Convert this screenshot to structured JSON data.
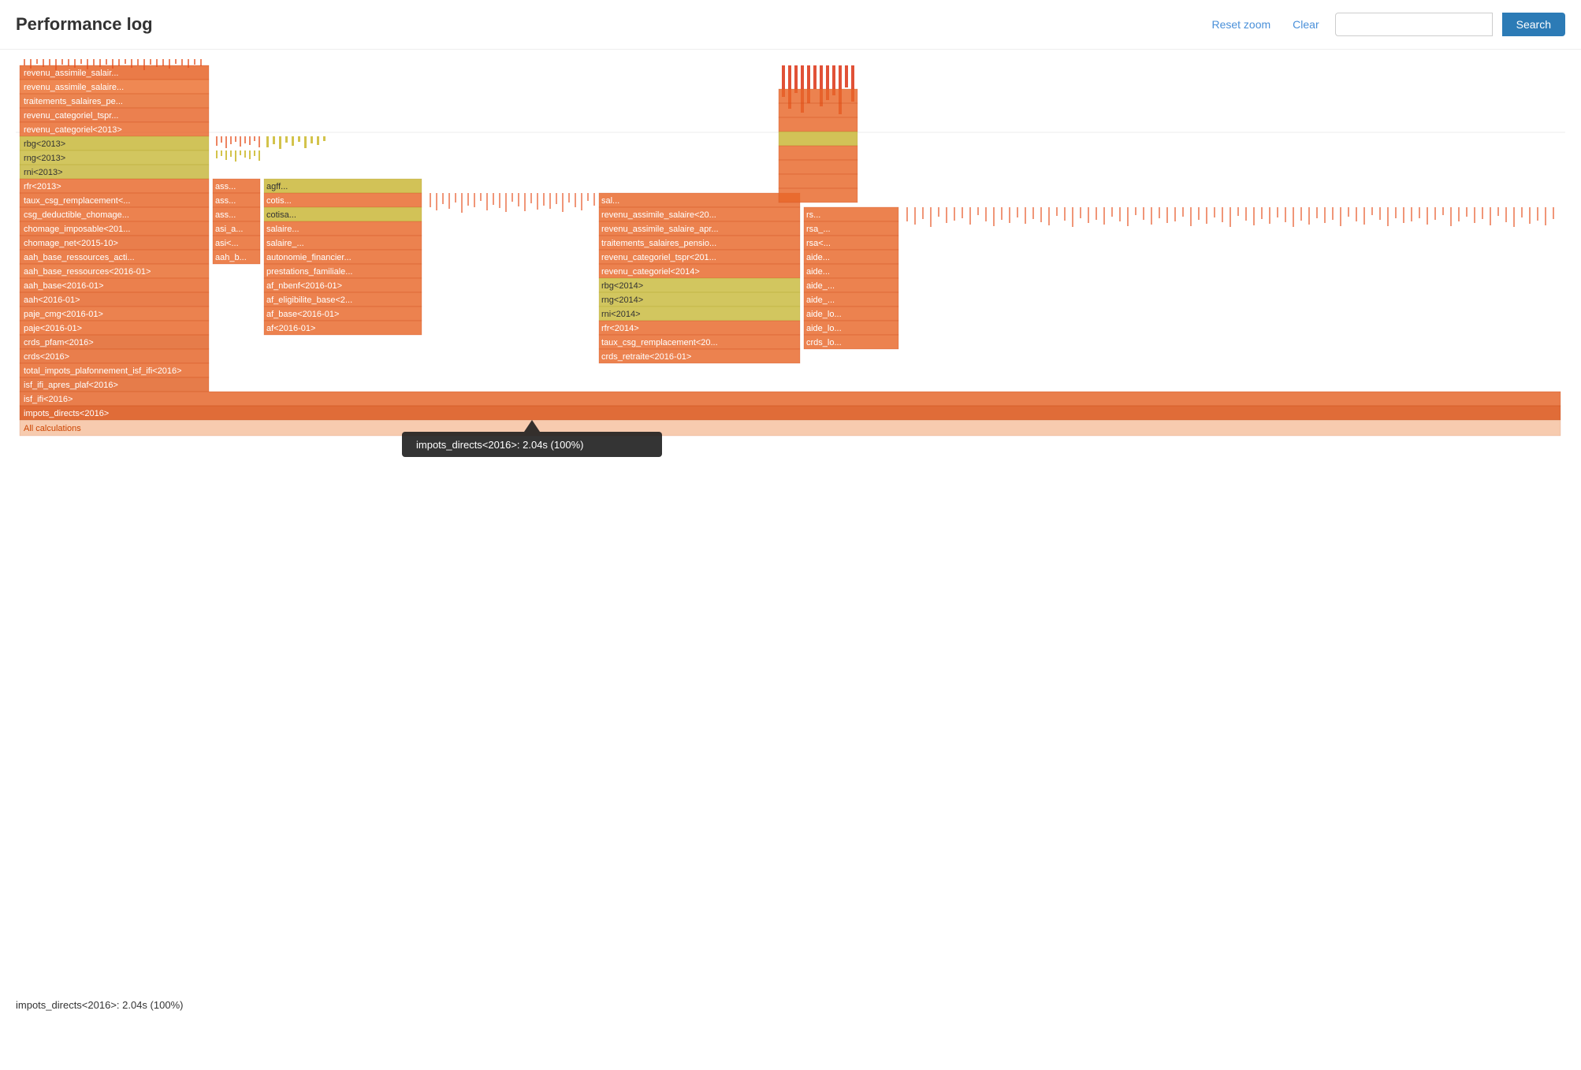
{
  "header": {
    "title": "Performance log",
    "reset_zoom_label": "Reset zoom",
    "clear_label": "Clear",
    "search_placeholder": "",
    "search_button_label": "Search"
  },
  "status_bar": {
    "text": "impots_directs<2016>: 2.04s (100%)"
  },
  "tooltip": {
    "text": "impots_directs<2016>: 2.04s (100%)"
  },
  "chart": {
    "all_calculations_label": "All calculations"
  },
  "rows": [
    {
      "label": "revenu_assimile_salair...",
      "depth": 8,
      "color": "orange"
    },
    {
      "label": "revenu_assimile_salaire...",
      "depth": 9,
      "color": "orange"
    },
    {
      "label": "traitements_salaires_pe...",
      "depth": 10,
      "color": "orange"
    },
    {
      "label": "revenu_categoriel_tspr...",
      "depth": 11,
      "color": "orange"
    },
    {
      "label": "revenu_categoriel<2013>",
      "depth": 12,
      "color": "orange"
    },
    {
      "label": "rbg<2013>",
      "depth": 13,
      "color": "yellow"
    },
    {
      "label": "rng<2013>",
      "depth": 14,
      "color": "yellow"
    },
    {
      "label": "rni<2013>",
      "depth": 15,
      "color": "yellow"
    },
    {
      "label": "rfr<2013>",
      "depth": 16,
      "color": "orange"
    },
    {
      "label": "taux_csg_remplacement<...",
      "depth": 17,
      "color": "orange"
    },
    {
      "label": "csg_deductible_chomage...",
      "depth": 18,
      "color": "orange"
    },
    {
      "label": "chomage_imposable<201...",
      "depth": 19,
      "color": "orange"
    },
    {
      "label": "chomage_net<2015-10>",
      "depth": 20,
      "color": "orange"
    },
    {
      "label": "aah_base_ressources_acti...",
      "depth": 21,
      "color": "orange"
    },
    {
      "label": "aah_base_ressources<2016-01>",
      "depth": 22,
      "color": "orange"
    },
    {
      "label": "aah_base<2016-01>",
      "depth": 23,
      "color": "orange"
    },
    {
      "label": "aah<2016-01>",
      "depth": 24,
      "color": "orange"
    },
    {
      "label": "paje_cmg<2016-01>",
      "depth": 25,
      "color": "orange"
    },
    {
      "label": "paje<2016-01>",
      "depth": 26,
      "color": "orange"
    },
    {
      "label": "crds_pfam<2016>",
      "depth": 27,
      "color": "orange"
    },
    {
      "label": "crds<2016>",
      "depth": 28,
      "color": "orange"
    },
    {
      "label": "total_impots_plafonnement_isf_ifi<2016>",
      "depth": 29,
      "color": "orange"
    },
    {
      "label": "isf_ifi_apres_plaf<2016>",
      "depth": 30,
      "color": "orange"
    },
    {
      "label": "isf_ifi<2016>",
      "depth": 31,
      "color": "orange"
    },
    {
      "label": "impots_directs<2016>",
      "depth": 32,
      "color": "dark-orange"
    }
  ]
}
